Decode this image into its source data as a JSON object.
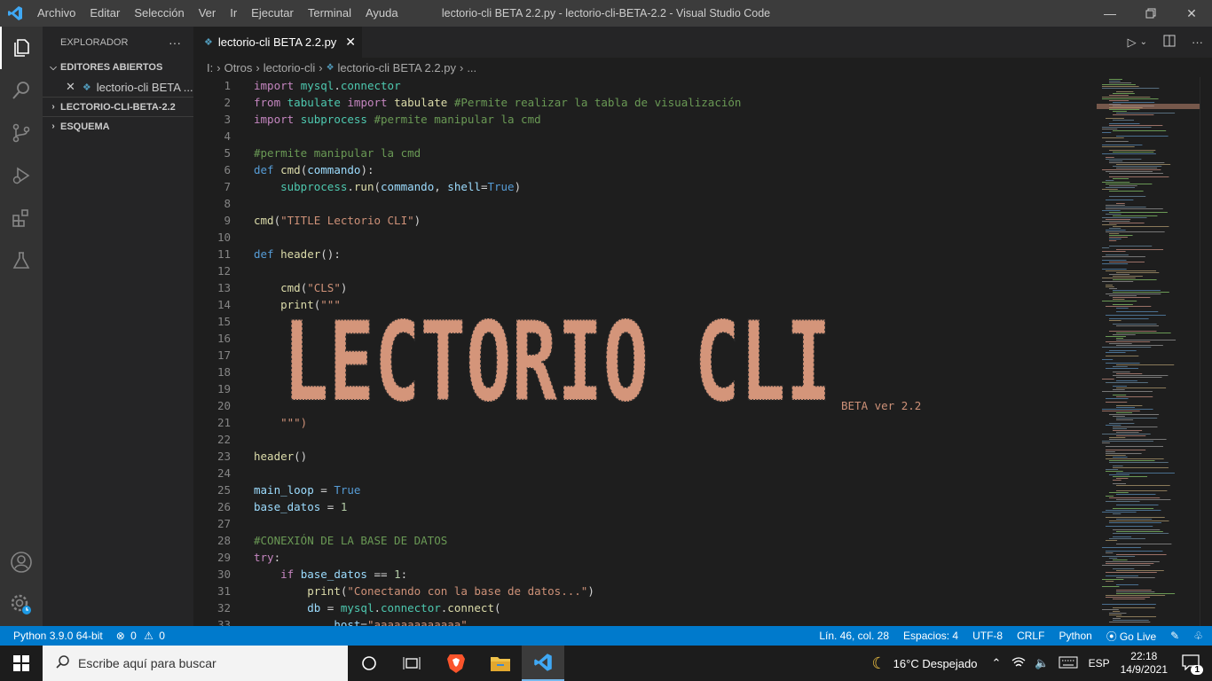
{
  "titlebar": {
    "menu": [
      "Archivo",
      "Editar",
      "Selección",
      "Ver",
      "Ir",
      "Ejecutar",
      "Terminal",
      "Ayuda"
    ],
    "title": "lectorio-cli BETA 2.2.py - lectorio-cli-BETA-2.2 - Visual Studio Code"
  },
  "sidebar": {
    "header": "EXPLORADOR",
    "open_editors": "EDITORES ABIERTOS",
    "open_file": "lectorio-cli BETA ...",
    "project": "LECTORIO-CLI-BETA-2.2",
    "outline": "ESQUEMA"
  },
  "tab": {
    "label": "lectorio-cli BETA 2.2.py"
  },
  "breadcrumb": [
    "I:",
    "Otros",
    "lectorio-cli",
    "lectorio-cli BETA 2.2.py",
    "..."
  ],
  "editor": {
    "line_numbers": [
      "1",
      "2",
      "3",
      "4",
      "5",
      "6",
      "7",
      "8",
      "9",
      "10",
      "11",
      "12",
      "13",
      "14",
      "15",
      "16",
      "17",
      "18",
      "19",
      "20",
      "21",
      "22",
      "23",
      "24",
      "25",
      "26",
      "27",
      "28",
      "29",
      "30",
      "31",
      "32",
      "33"
    ],
    "banner_text": "LECTORIO CLI",
    "banner_suffix": "BETA ver 2.2"
  },
  "statusbar": {
    "python": "Python 3.9.0 64-bit",
    "errors": "0",
    "warnings": "0",
    "position": "Lín. 46, col. 28",
    "spaces": "Espacios: 4",
    "encoding": "UTF-8",
    "eol": "CRLF",
    "language": "Python",
    "golive": "Go Live"
  },
  "taskbar": {
    "search_placeholder": "Escribe aquí para buscar",
    "weather": "16°C  Despejado",
    "lang": "ESP",
    "time": "22:18",
    "date": "14/9/2021",
    "notifications": "1"
  },
  "colors": {
    "accent": "#007acc",
    "keyword": "#c586c0",
    "builtin": "#569cd6",
    "function": "#dcdcaa",
    "string": "#ce9178",
    "comment": "#6a9955",
    "number": "#b5cea8",
    "variable": "#9cdcfe",
    "module": "#4ec9b0"
  }
}
